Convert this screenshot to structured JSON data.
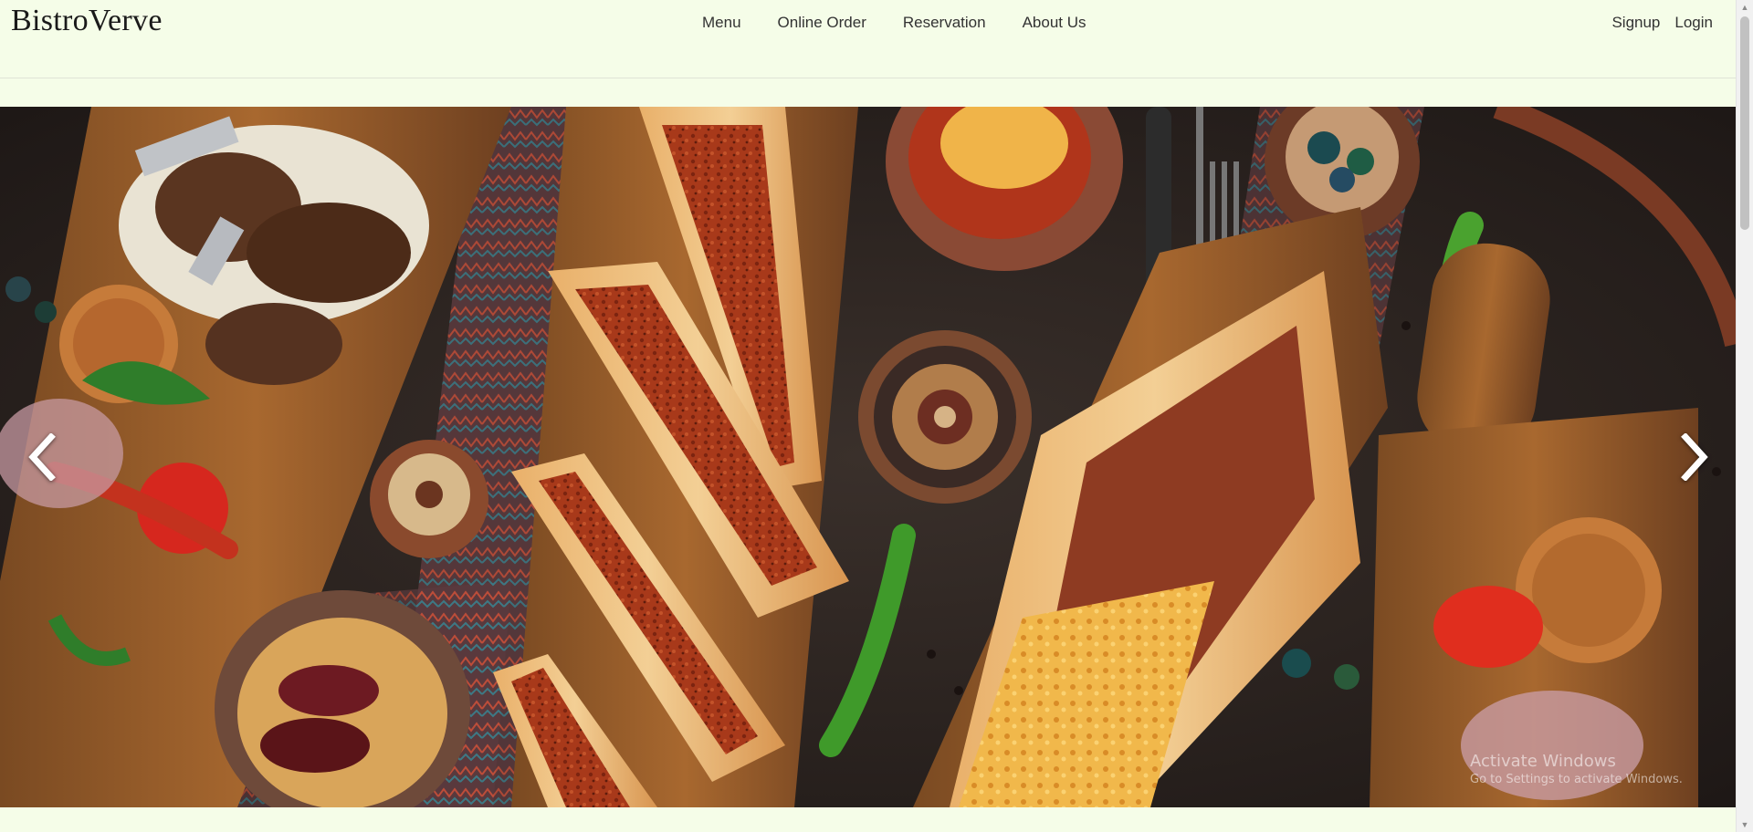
{
  "brand": {
    "name": "BistroVerve"
  },
  "nav": {
    "items": [
      {
        "label": "Menu"
      },
      {
        "label": "Online Order"
      },
      {
        "label": "Reservation"
      },
      {
        "label": "About Us"
      }
    ]
  },
  "auth": {
    "signup": "Signup",
    "login": "Login"
  },
  "carousel": {
    "prev_icon": "chevron-left-icon",
    "next_icon": "chevron-right-icon",
    "image_description_icon": "hero-food-image"
  },
  "watermark": {
    "line1": "Activate Windows",
    "line2": "Go to Settings to activate Windows."
  },
  "colors": {
    "background": "#f5fde8",
    "text": "#333333",
    "brand_text": "#1a1a1a"
  }
}
